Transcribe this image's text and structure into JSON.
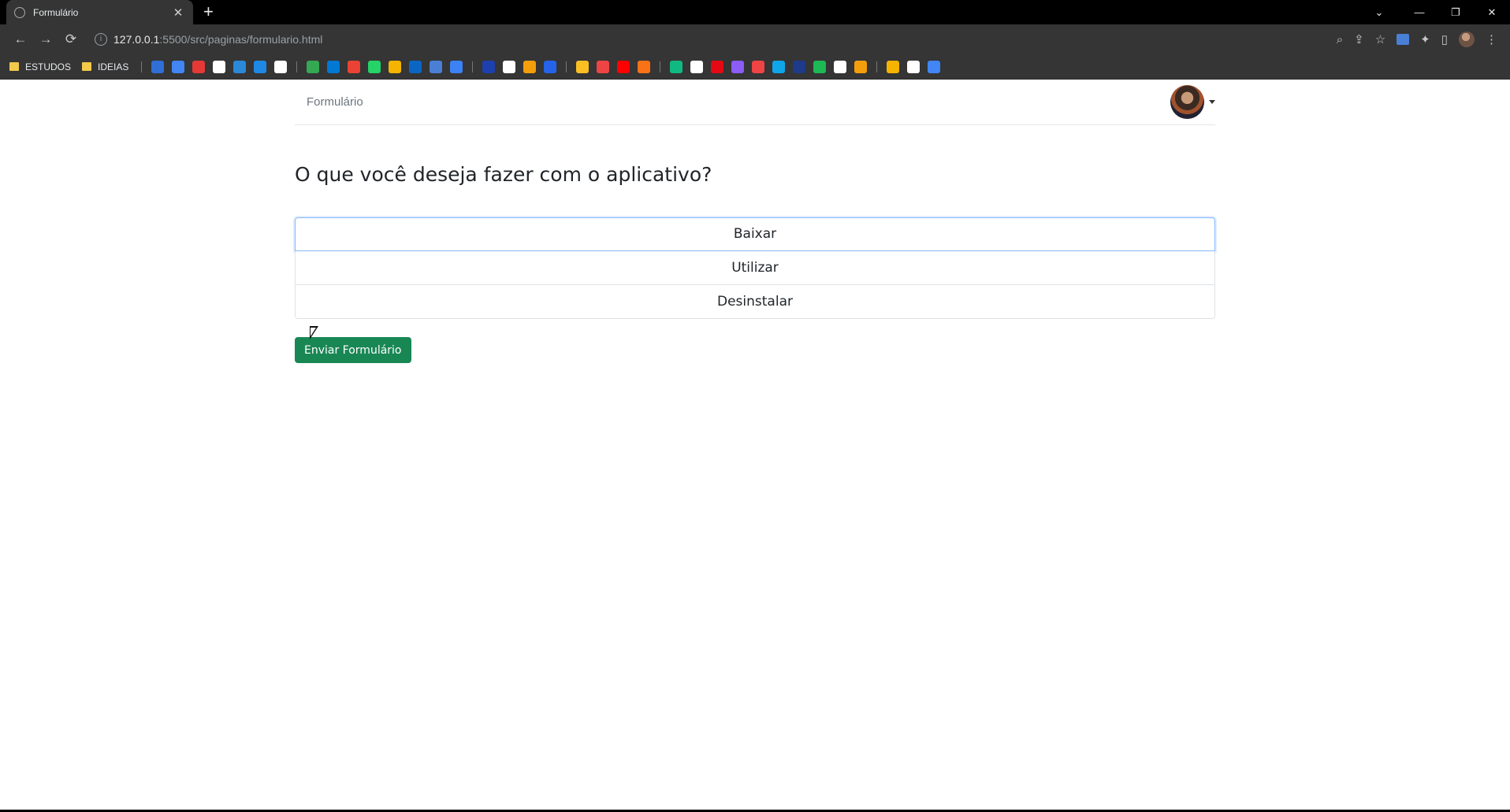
{
  "browser": {
    "tab_title": "Formulário",
    "tab_close": "✕",
    "new_tab": "+",
    "window_controls": {
      "tab_search": "⌄",
      "minimize": "—",
      "restore": "❐",
      "close": "✕"
    },
    "nav": {
      "back": "←",
      "forward": "→",
      "reload": "⟳"
    },
    "url_info": "i",
    "url_host": "127.0.0.1",
    "url_path": ":5500/src/paginas/formulario.html",
    "toolbar_icons": {
      "zoom": "⌕",
      "share": "⇪",
      "star": "☆",
      "extensions": "✦",
      "sidepanel": "▯",
      "menu": "⋮"
    }
  },
  "bookmarks": {
    "folders": [
      "ESTUDOS",
      "IDEIAS"
    ],
    "icon_colors": [
      "#2f6fd6",
      "#4285f4",
      "#e53935",
      "#ffffff",
      "#2b88d8",
      "#1e88e5",
      "#ffffff",
      "#34a853",
      "#0078d4",
      "#ea4335",
      "#25d366",
      "#f4b400",
      "#0a66c2",
      "#4a7fd6",
      "#3b82f6",
      "#1e40af",
      "#ffffff",
      "#f59e0b",
      "#2563eb",
      "#fbbf24",
      "#ef4444",
      "#ff0000",
      "#f97316",
      "#10b981",
      "#ffffff",
      "#e50914",
      "#8b5cf6",
      "#ef4444",
      "#0ea5e9",
      "#1e3a8a",
      "#1db954",
      "#ffffff",
      "#f59e0b",
      "#f4b400",
      "#ffffff",
      "#4285f4"
    ]
  },
  "page": {
    "brand": "Formulário",
    "question": "O que você deseja fazer com o aplicativo?",
    "options": [
      "Baixar",
      "Utilizar",
      "Desinstalar"
    ],
    "selected_option": "Baixar",
    "submit_label": "Enviar Formulário"
  },
  "colors": {
    "submit_bg": "#198754",
    "focus_border": "#86b7fe"
  }
}
